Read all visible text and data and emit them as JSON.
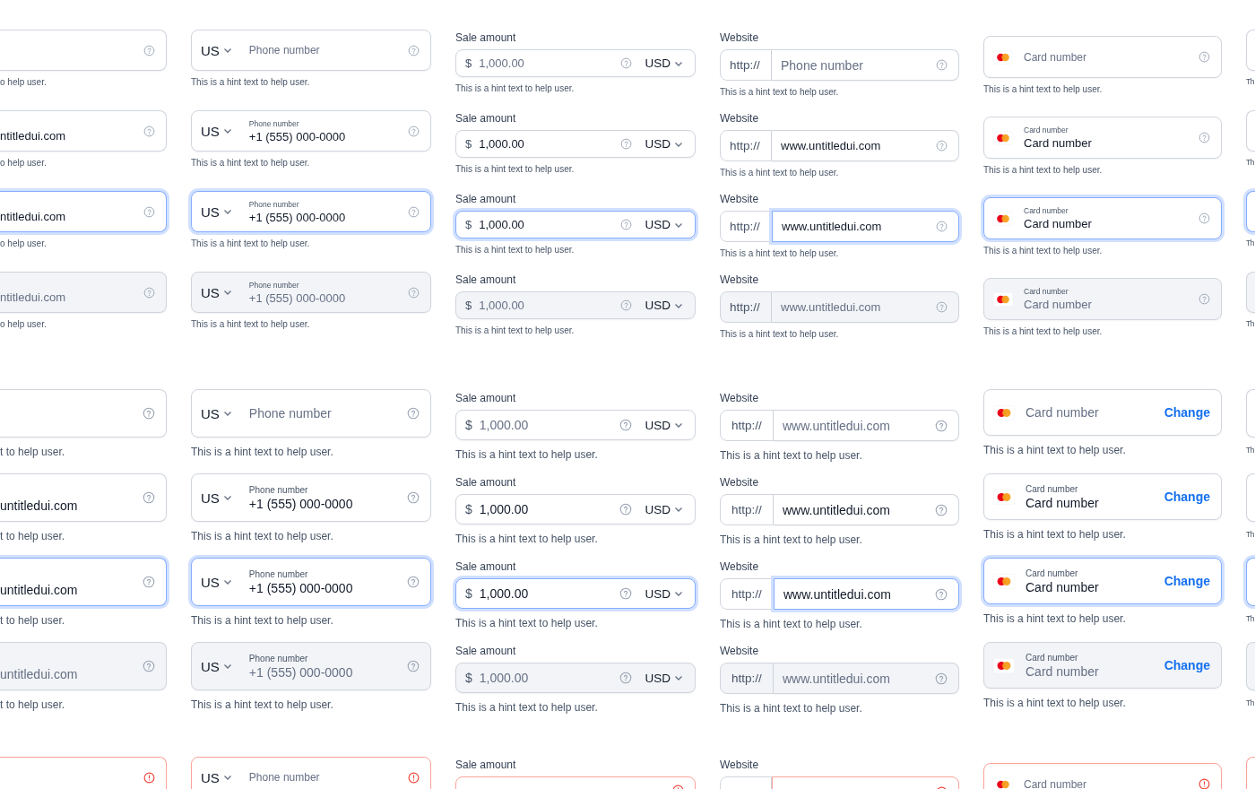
{
  "sections": [
    {
      "kind": "small",
      "rows": [
        [
          {
            "kind": "text",
            "hint": "o help user.",
            "focused": false,
            "disabled": false,
            "error": false
          },
          {
            "kind": "phone",
            "country": "US",
            "placeholder": "Phone number",
            "hint": "This is a hint text to help user.",
            "focused": false,
            "disabled": false,
            "error": false
          },
          {
            "kind": "amount",
            "label": "Sale amount",
            "symbol": "$",
            "placeholder": "1,000.00",
            "currency": "USD",
            "hint": "This is a hint text to help user.",
            "focused": false,
            "disabled": false,
            "error": false
          },
          {
            "kind": "website",
            "label": "Website",
            "prefix": "http://",
            "placeholder": "Phone number",
            "hint": "This is a hint text to help user.",
            "focused": false,
            "disabled": false,
            "error": false
          },
          {
            "kind": "card",
            "placeholder": "Card number",
            "hint": "This is a hint text to help user.",
            "focused": false,
            "disabled": false,
            "error": false
          },
          {
            "kind": "edge",
            "hint": "Th",
            "focused": false,
            "disabled": false,
            "error": false
          }
        ],
        [
          {
            "kind": "text",
            "value": "ntitledui.com",
            "hint": "o help user.",
            "focused": false,
            "disabled": false,
            "error": false
          },
          {
            "kind": "phone",
            "country": "US",
            "floating_label": "Phone number",
            "value": "+1 (555) 000-0000",
            "hint": "This is a hint text to help user.",
            "focused": false,
            "disabled": false,
            "error": false
          },
          {
            "kind": "amount",
            "label": "Sale amount",
            "symbol": "$",
            "value": "1,000.00",
            "currency": "USD",
            "hint": "This is a hint text to help user.",
            "focused": false,
            "disabled": false,
            "error": false
          },
          {
            "kind": "website",
            "label": "Website",
            "prefix": "http://",
            "value": "www.untitledui.com",
            "hint": "This is a hint text to help user.",
            "focused": false,
            "disabled": false,
            "error": false
          },
          {
            "kind": "card",
            "floating_label": "Card number",
            "value": "Card number",
            "hint": "This is a hint text to help user.",
            "focused": false,
            "disabled": false,
            "error": false
          },
          {
            "kind": "edge",
            "hint": "Th",
            "focused": false,
            "disabled": false,
            "error": false
          }
        ],
        [
          {
            "kind": "text",
            "value": "ntitledui.com",
            "hint": "o help user.",
            "focused": true,
            "disabled": false,
            "error": false
          },
          {
            "kind": "phone",
            "country": "US",
            "floating_label": "Phone number",
            "value": "+1 (555) 000-0000",
            "hint": "This is a hint text to help user.",
            "focused": true,
            "disabled": false,
            "error": false
          },
          {
            "kind": "amount",
            "label": "Sale amount",
            "symbol": "$",
            "value": "1,000.00",
            "currency": "USD",
            "hint": "This is a hint text to help user.",
            "focused": true,
            "disabled": false,
            "error": false
          },
          {
            "kind": "website",
            "label": "Website",
            "prefix": "http://",
            "value": "www.untitledui.com",
            "hint": "This is a hint text to help user.",
            "focused": true,
            "disabled": false,
            "error": false
          },
          {
            "kind": "card",
            "floating_label": "Card number",
            "value": "Card number",
            "hint": "This is a hint text to help user.",
            "focused": true,
            "disabled": false,
            "error": false
          },
          {
            "kind": "edge",
            "hint": "Th",
            "focused": true,
            "disabled": false,
            "error": false
          }
        ],
        [
          {
            "kind": "text",
            "value": "ntitledui.com",
            "hint": "o help user.",
            "focused": false,
            "disabled": true,
            "error": false
          },
          {
            "kind": "phone",
            "country": "US",
            "floating_label": "Phone number",
            "value": "+1 (555) 000-0000",
            "hint": "This is a hint text to help user.",
            "focused": false,
            "disabled": true,
            "error": false
          },
          {
            "kind": "amount",
            "label": "Sale amount",
            "symbol": "$",
            "value": "1,000.00",
            "currency": "USD",
            "hint": "This is a hint text to help user.",
            "focused": false,
            "disabled": true,
            "error": false
          },
          {
            "kind": "website",
            "label": "Website",
            "prefix": "http://",
            "value": "www.untitledui.com",
            "hint": "This is a hint text to help user.",
            "focused": false,
            "disabled": true,
            "error": false
          },
          {
            "kind": "card",
            "floating_label": "Card number",
            "value": "Card number",
            "hint": "This is a hint text to help user.",
            "focused": false,
            "disabled": true,
            "error": false
          },
          {
            "kind": "edge",
            "hint": "Th",
            "focused": false,
            "disabled": true,
            "error": false
          }
        ]
      ]
    },
    {
      "kind": "large",
      "rows": [
        [
          {
            "kind": "text",
            "hint": "t to help user.",
            "focused": false,
            "disabled": false,
            "error": false
          },
          {
            "kind": "phone",
            "country": "US",
            "placeholder": "Phone number",
            "hint": "This is a hint text to help user.",
            "focused": false,
            "disabled": false,
            "error": false
          },
          {
            "kind": "amount",
            "label": "Sale amount",
            "symbol": "$",
            "placeholder": "1,000.00",
            "currency": "USD",
            "hint": "This is a hint text to help user.",
            "focused": false,
            "disabled": false,
            "error": false
          },
          {
            "kind": "website",
            "label": "Website",
            "prefix": "http://",
            "placeholder": "www.untitledui.com",
            "hint": "This is a hint text to help user.",
            "focused": false,
            "disabled": false,
            "error": false
          },
          {
            "kind": "card",
            "placeholder": "Card number",
            "action": "Change",
            "hint": "This is a hint text to help user.",
            "focused": false,
            "disabled": false,
            "error": false
          },
          {
            "kind": "edge",
            "hint": "Th",
            "focused": false,
            "disabled": false,
            "error": false
          }
        ],
        [
          {
            "kind": "text",
            "value": "untitledui.com",
            "hint": "t to help user.",
            "focused": false,
            "disabled": false,
            "error": false
          },
          {
            "kind": "phone",
            "country": "US",
            "floating_label": "Phone number",
            "value": "+1 (555) 000-0000",
            "hint": "This is a hint text to help user.",
            "focused": false,
            "disabled": false,
            "error": false
          },
          {
            "kind": "amount",
            "label": "Sale amount",
            "symbol": "$",
            "value": "1,000.00",
            "currency": "USD",
            "hint": "This is a hint text to help user.",
            "focused": false,
            "disabled": false,
            "error": false
          },
          {
            "kind": "website",
            "label": "Website",
            "prefix": "http://",
            "value": "www.untitledui.com",
            "hint": "This is a hint text to help user.",
            "focused": false,
            "disabled": false,
            "error": false
          },
          {
            "kind": "card",
            "floating_label": "Card number",
            "value": "Card number",
            "action": "Change",
            "hint": "This is a hint text to help user.",
            "focused": false,
            "disabled": false,
            "error": false
          },
          {
            "kind": "edge",
            "hint": "Th",
            "focused": false,
            "disabled": false,
            "error": false
          }
        ],
        [
          {
            "kind": "text",
            "value": "untitledui.com",
            "hint": "t to help user.",
            "focused": true,
            "disabled": false,
            "error": false
          },
          {
            "kind": "phone",
            "country": "US",
            "floating_label": "Phone number",
            "value": "+1 (555) 000-0000",
            "hint": "This is a hint text to help user.",
            "focused": true,
            "disabled": false,
            "error": false
          },
          {
            "kind": "amount",
            "label": "Sale amount",
            "symbol": "$",
            "value": "1,000.00",
            "currency": "USD",
            "hint": "This is a hint text to help user.",
            "focused": true,
            "disabled": false,
            "error": false
          },
          {
            "kind": "website",
            "label": "Website",
            "prefix": "http://",
            "value": "www.untitledui.com",
            "hint": "This is a hint text to help user.",
            "focused": true,
            "disabled": false,
            "error": false
          },
          {
            "kind": "card",
            "floating_label": "Card number",
            "value": "Card number",
            "action": "Change",
            "hint": "This is a hint text to help user.",
            "focused": true,
            "disabled": false,
            "error": false
          },
          {
            "kind": "edge",
            "hint": "Th",
            "focused": true,
            "disabled": false,
            "error": false
          }
        ],
        [
          {
            "kind": "text",
            "value": "untitledui.com",
            "hint": "t to help user.",
            "focused": false,
            "disabled": true,
            "error": false
          },
          {
            "kind": "phone",
            "country": "US",
            "floating_label": "Phone number",
            "value": "+1 (555) 000-0000",
            "hint": "This is a hint text to help user.",
            "focused": false,
            "disabled": true,
            "error": false
          },
          {
            "kind": "amount",
            "label": "Sale amount",
            "symbol": "$",
            "value": "1,000.00",
            "currency": "USD",
            "hint": "This is a hint text to help user.",
            "focused": false,
            "disabled": true,
            "error": false
          },
          {
            "kind": "website",
            "label": "Website",
            "prefix": "http://",
            "value": "www.untitledui.com",
            "hint": "This is a hint text to help user.",
            "focused": false,
            "disabled": true,
            "error": false
          },
          {
            "kind": "card",
            "floating_label": "Card number",
            "value": "Card number",
            "action": "Change",
            "hint": "This is a hint text to help user.",
            "focused": false,
            "disabled": true,
            "error": false
          },
          {
            "kind": "edge",
            "hint": "Th",
            "focused": false,
            "disabled": true,
            "error": false
          }
        ]
      ]
    },
    {
      "kind": "small",
      "rows": [
        [
          {
            "kind": "text",
            "focused": false,
            "disabled": false,
            "error": true
          },
          {
            "kind": "phone",
            "country": "US",
            "placeholder": "Phone number",
            "focused": false,
            "disabled": false,
            "error": true
          },
          {
            "kind": "amount",
            "label": "Sale amount",
            "focused": false,
            "disabled": false,
            "error": true
          },
          {
            "kind": "website",
            "label": "Website",
            "focused": false,
            "disabled": false,
            "error": true
          },
          {
            "kind": "card",
            "placeholder": "Card number",
            "focused": false,
            "disabled": false,
            "error": true
          },
          {
            "kind": "edge",
            "focused": false,
            "disabled": false,
            "error": true
          }
        ]
      ]
    }
  ]
}
